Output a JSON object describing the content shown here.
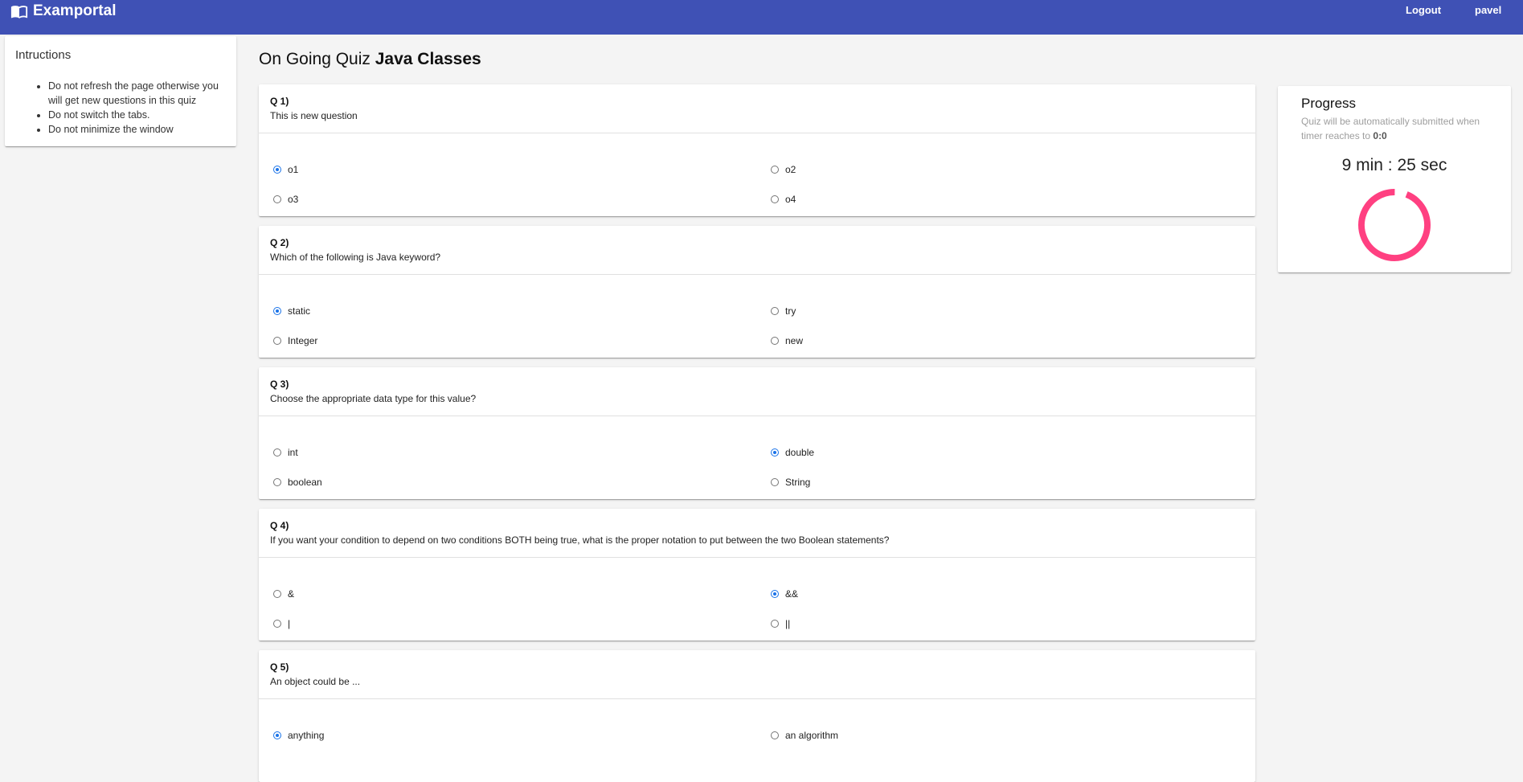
{
  "app": {
    "name": "Examportal"
  },
  "nav": {
    "logout": "Logout",
    "user": "pavel"
  },
  "instructions": {
    "title": "Intructions",
    "items": [
      "Do not refresh the page otherwise you will get new questions in this quiz",
      "Do not switch the tabs.",
      "Do not minimize the window"
    ]
  },
  "page": {
    "title_prefix": "On Going Quiz",
    "quiz_name": "Java Classes"
  },
  "questions": [
    {
      "num": "Q 1)",
      "text": "This is new question",
      "options": [
        "o1",
        "o2",
        "o3",
        "o4"
      ],
      "selected": 0
    },
    {
      "num": "Q 2)",
      "text": "Which of the following is Java keyword?",
      "options": [
        "static",
        "try",
        "Integer",
        "new"
      ],
      "selected": 0
    },
    {
      "num": "Q 3)",
      "text": "Choose the appropriate data type for this value?",
      "options": [
        "int",
        "double",
        "boolean",
        "String"
      ],
      "selected": 1
    },
    {
      "num": "Q 4)",
      "text": "If you want your condition to depend on two conditions BOTH being true, what is the proper notation to put between the two Boolean statements?",
      "options": [
        "&",
        "&&",
        "|",
        "||"
      ],
      "selected": 1
    },
    {
      "num": "Q 5)",
      "text": "An object could be ...",
      "options": [
        "anything",
        "an algorithm"
      ],
      "selected": 0
    }
  ],
  "progress": {
    "title": "Progress",
    "subtitle": "Quiz will be automatically submitted when timer reaches to",
    "subtitle_value": "0:0",
    "timer": "9 min : 25 sec",
    "remaining_fraction": 0.94,
    "ring_color": "#ff4081"
  },
  "colors": {
    "header": "#3f51b5",
    "accent": "#1a73e8"
  }
}
